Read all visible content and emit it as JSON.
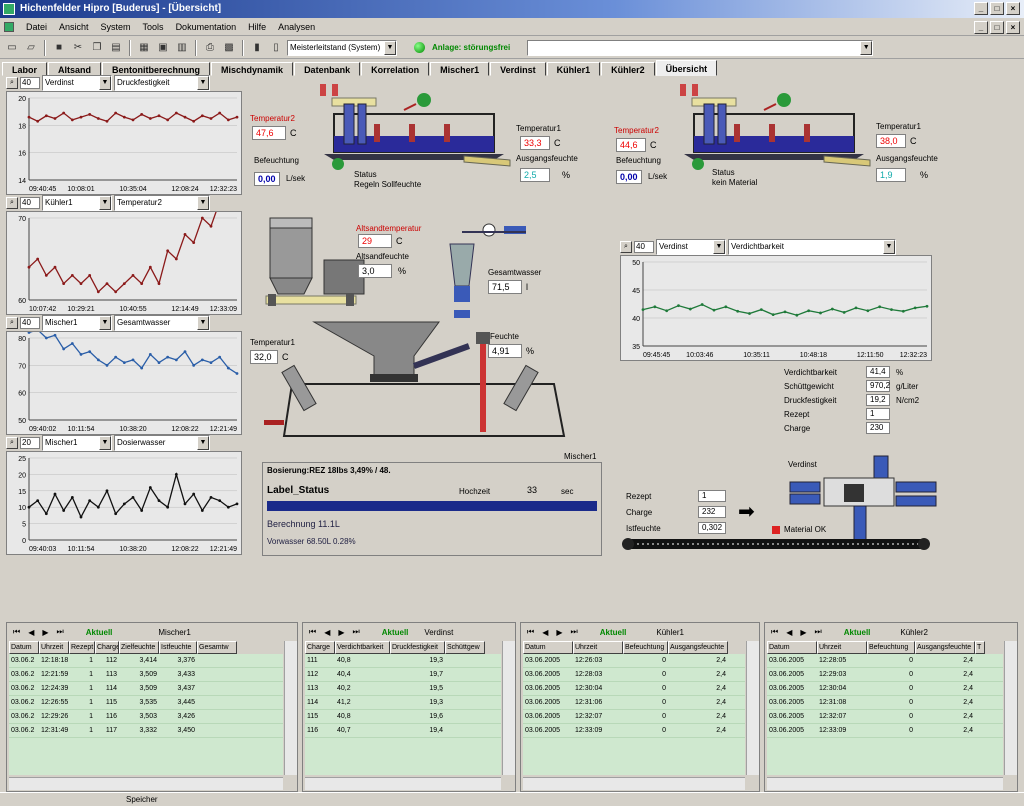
{
  "window": {
    "title": "Hichenfelder Hipro [Buderus] - [Übersicht]"
  },
  "menu": [
    "Datei",
    "Ansicht",
    "System",
    "Tools",
    "Dokumentation",
    "Hilfe",
    "Analysen"
  ],
  "toolbar": {
    "user_combo": "Meisterleitstand (System)",
    "status_text": "Anlage: störungsfrei"
  },
  "tabs": [
    "Labor",
    "Altsand",
    "Bentonitberechnung",
    "Mischdynamik",
    "Datenbank",
    "Korrelation",
    "Mischer1",
    "Verdinst",
    "Kühler1",
    "Kühler2",
    "Übersicht"
  ],
  "trends": [
    {
      "spin": "40",
      "source": "Verdinst",
      "param": "Druckfestigkeit",
      "yticks": [
        "20",
        "18",
        "16",
        "14"
      ],
      "xticks": [
        "09:40:45",
        "10:08:01",
        "10:35:04",
        "12:08:24",
        "12:32:23"
      ],
      "color": "#8b1a1a",
      "values": [
        18.6,
        18.3,
        18.7,
        18.5,
        18.9,
        18.4,
        18.6,
        18.8,
        18.5,
        18.3,
        18.9,
        18.6,
        18.4,
        18.8,
        18.5,
        18.7,
        18.4,
        18.9,
        18.6,
        18.3,
        18.7,
        18.5,
        18.9,
        18.4,
        18.6
      ]
    },
    {
      "spin": "40",
      "source": "Kühler1",
      "param": "Temperatur2",
      "yticks": [
        "70",
        "60"
      ],
      "xticks": [
        "10:07:42",
        "10:29:21",
        "10:40:55",
        "12:14:49",
        "12:33:09"
      ],
      "color": "#8b1a1a",
      "values": [
        64,
        65,
        63,
        64,
        62,
        63,
        62,
        63,
        61,
        62,
        61,
        62,
        63,
        62,
        64,
        62,
        66,
        65,
        68,
        67,
        70,
        69,
        72,
        71,
        71
      ]
    },
    {
      "spin": "40",
      "source": "Mischer1",
      "param": "Gesamtwasser",
      "yticks": [
        "80",
        "70",
        "60",
        "50"
      ],
      "xticks": [
        "09:40:02",
        "10:11:54",
        "10:38:20",
        "12:08:22",
        "12:21:49"
      ],
      "color": "#2a5ea8",
      "values": [
        82,
        83,
        80,
        81,
        76,
        78,
        74,
        75,
        72,
        70,
        73,
        71,
        72,
        69,
        74,
        71,
        73,
        72,
        75,
        70,
        72,
        71,
        73,
        69,
        67
      ]
    },
    {
      "spin": "20",
      "source": "Mischer1",
      "param": "Dosierwasser",
      "yticks": [
        "25",
        "20",
        "15",
        "10",
        "5",
        "0"
      ],
      "xticks": [
        "09:40:03",
        "10:11:54",
        "10:38:20",
        "12:08:22",
        "12:21:49"
      ],
      "color": "#111111",
      "values": [
        10,
        12,
        8,
        14,
        9,
        13,
        7,
        12,
        10,
        15,
        8,
        11,
        13,
        9,
        16,
        12,
        10,
        20,
        11,
        14,
        9,
        13,
        12,
        10,
        11
      ]
    }
  ],
  "labels": {
    "t2a": "Temperatur2",
    "t2a_val": "47,6",
    "t2a_unit": "C",
    "befa": "Befeuchtung",
    "befa_val": "0,00",
    "befa_unit": "L/sek",
    "t1a": "Temperatur1",
    "t1a_val": "33,3",
    "t1a_unit": "C",
    "ausa": "Ausgangsfeuchte",
    "ausa_val": "2,5",
    "ausa_unit": "%",
    "stata": "Status",
    "stata_val": "Regeln Sollfeuchte",
    "t2b": "Temperatur2",
    "t2b_val": "44,6",
    "t2b_unit": "C",
    "befb": "Befeuchtung",
    "befb_val": "0,00",
    "befb_unit": "L/sek",
    "t1b": "Temperatur1",
    "t1b_val": "38,0",
    "t1b_unit": "C",
    "ausb": "Ausgangsfeuchte",
    "ausb_val": "1,9",
    "ausb_unit": "%",
    "statb": "Status",
    "statb_val": "kein Material",
    "alt_temp": "Altsandtemperatur",
    "alt_temp_val": "29",
    "alt_temp_unit": "C",
    "alt_feuchte": "Altsandfeuchte",
    "alt_feuchte_val": "3,0",
    "alt_feuchte_unit": "%",
    "gesamtwasser": "Gesamtwasser",
    "gesamtwasser_val": "71,5",
    "gesamtwasser_unit": "l",
    "feuchte": "Feuchte",
    "feuchte_val": "4,91",
    "feuchte_unit": "%",
    "temp1m": "Temperatur1",
    "temp1m_val": "32,0",
    "temp1m_unit": "C",
    "mischer1": "Mischer1"
  },
  "statuspanel": {
    "head": "Bosierung:REZ 18Ibs 3,49% / 48.",
    "title": "Label_Status",
    "hochzeit": "Hochzeit",
    "num": "33",
    "unit": "sec",
    "calc": "Berechnung  11.1L",
    "vorwasser": "Vorwasser 68.50L 0.28%"
  },
  "rightchart": {
    "spin": "40",
    "source": "Verdinst",
    "param": "Verdichtbarkeit",
    "yticks": [
      "50",
      "45",
      "40",
      "35"
    ],
    "xticks": [
      "09:45:45",
      "10:03:46",
      "10:35:11",
      "10:48:18",
      "12:11:50",
      "12:32:23"
    ],
    "color": "#1f7a3a",
    "values": [
      41.5,
      42,
      41.3,
      42.2,
      41.6,
      42.4,
      41.4,
      42,
      41.2,
      40.8,
      41.5,
      40.6,
      41.1,
      40.5,
      41.3,
      40.9,
      41.6,
      41,
      41.8,
      41.3,
      42,
      41.5,
      41.2,
      41.8,
      42.1
    ]
  },
  "props": [
    {
      "label": "Verdichtbarkeit",
      "val": "41,4",
      "unit": "%"
    },
    {
      "label": "Schüttgewicht",
      "val": "970,2",
      "unit": "g/Liter"
    },
    {
      "label": "Druckfestigkeit",
      "val": "19,2",
      "unit": "N/cm2"
    },
    {
      "label": "Rezept",
      "val": "1",
      "unit": ""
    },
    {
      "label": "Charge",
      "val": "230",
      "unit": ""
    }
  ],
  "verdinst_label": "Verdinst",
  "conveyor": [
    {
      "label": "Rezept",
      "val": "1"
    },
    {
      "label": "Charge",
      "val": "232"
    },
    {
      "label": "Istfeuchte",
      "val": "0,302"
    }
  ],
  "material_ok": "Material OK",
  "grids": [
    {
      "title": "Mischer1",
      "cols": [
        "Datum",
        "Uhrzeit",
        "Rezept",
        "Charge",
        "Zielfeuchte",
        "Istfeuchte",
        "Gesamtw"
      ],
      "widths": [
        30,
        30,
        26,
        24,
        40,
        38,
        40
      ],
      "rows": [
        [
          "03.06.2",
          "12:18:18",
          "1",
          "112",
          "3,414",
          "3,376",
          ""
        ],
        [
          "03.06.2",
          "12:21:59",
          "1",
          "113",
          "3,509",
          "3,433",
          ""
        ],
        [
          "03.06.2",
          "12:24:39",
          "1",
          "114",
          "3,509",
          "3,437",
          ""
        ],
        [
          "03.06.2",
          "12:26:55",
          "1",
          "115",
          "3,535",
          "3,445",
          ""
        ],
        [
          "03.06.2",
          "12:29:26",
          "1",
          "116",
          "3,503",
          "3,426",
          ""
        ],
        [
          "03.06.2",
          "12:31:49",
          "1",
          "117",
          "3,332",
          "3,450",
          ""
        ]
      ]
    },
    {
      "title": "Verdinst",
      "cols": [
        "Charge",
        "Verdichtbarkeit",
        "Druckfestigkeit",
        "Schüttgew"
      ],
      "widths": [
        30,
        55,
        55,
        40
      ],
      "rows": [
        [
          "111",
          "40,8",
          "19,3",
          ""
        ],
        [
          "112",
          "40,4",
          "19,7",
          ""
        ],
        [
          "113",
          "40,2",
          "19,5",
          ""
        ],
        [
          "114",
          "41,2",
          "19,3",
          ""
        ],
        [
          "115",
          "40,8",
          "19,6",
          ""
        ],
        [
          "116",
          "40,7",
          "19,4",
          ""
        ]
      ]
    },
    {
      "title": "Kühler1",
      "cols": [
        "Datum",
        "Uhrzeit",
        "Befeuchtung",
        "Ausgangsfeuchte"
      ],
      "widths": [
        50,
        50,
        45,
        60
      ],
      "rows": [
        [
          "03.06.2005",
          "12:26:03",
          "0",
          "2,4"
        ],
        [
          "03.06.2005",
          "12:28:03",
          "0",
          "2,4"
        ],
        [
          "03.06.2005",
          "12:30:04",
          "0",
          "2,4"
        ],
        [
          "03.06.2005",
          "12:31:06",
          "0",
          "2,4"
        ],
        [
          "03.06.2005",
          "12:32:07",
          "0",
          "2,4"
        ],
        [
          "03.06.2005",
          "12:33:09",
          "0",
          "2,4"
        ]
      ]
    },
    {
      "title": "Kühler2",
      "cols": [
        "Datum",
        "Uhrzeit",
        "Befeuchtung",
        "Ausgangsfeuchte",
        "T"
      ],
      "widths": [
        50,
        50,
        48,
        60,
        10
      ],
      "rows": [
        [
          "03.06.2005",
          "12:28:05",
          "0",
          "2,4",
          ""
        ],
        [
          "03.06.2005",
          "12:29:03",
          "0",
          "2,4",
          ""
        ],
        [
          "03.06.2005",
          "12:30:04",
          "0",
          "2,4",
          ""
        ],
        [
          "03.06.2005",
          "12:31:08",
          "0",
          "2,4",
          ""
        ],
        [
          "03.06.2005",
          "12:32:07",
          "0",
          "2,4",
          ""
        ],
        [
          "03.06.2005",
          "12:33:09",
          "0",
          "2,4",
          ""
        ]
      ]
    }
  ],
  "statusbar": "Speicher"
}
